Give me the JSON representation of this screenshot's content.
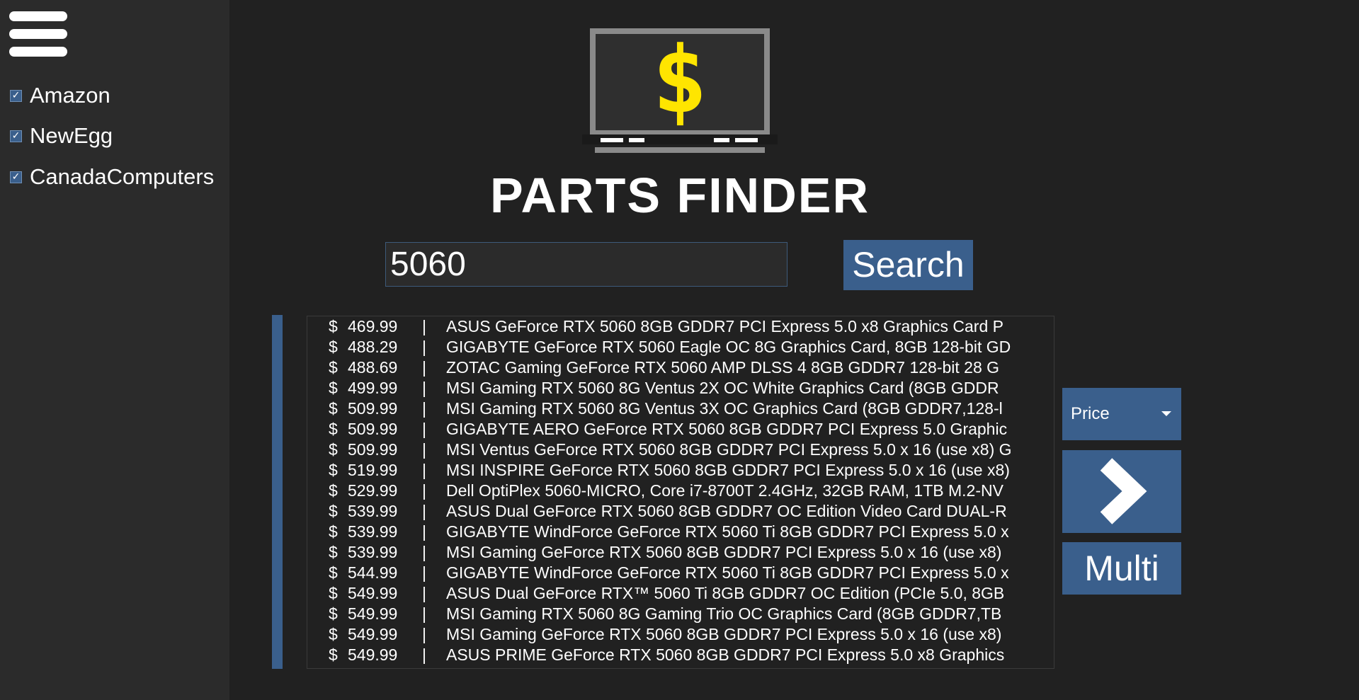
{
  "app": {
    "title": "PARTS FINDER"
  },
  "colors": {
    "background": "#212121",
    "sidebar": "#2b2b2b",
    "accent": "#3a5f8c",
    "logo_dollar": "#ffe500",
    "logo_frame": "#8a8a8a"
  },
  "sidebar": {
    "menu_icon": "hamburger-menu-icon",
    "stores": [
      {
        "label": "Amazon",
        "checked": true
      },
      {
        "label": "NewEgg",
        "checked": true
      },
      {
        "label": "CanadaComputers",
        "checked": true
      }
    ],
    "check_glyph": "✓"
  },
  "logo": {
    "icon": "monitor-dollar-icon",
    "glyph": "$"
  },
  "search": {
    "value": "5060",
    "button_label": "Search"
  },
  "results": {
    "currency": "$",
    "separator": "|",
    "rows": [
      {
        "price": "469.99",
        "name": "ASUS GeForce RTX 5060 8GB GDDR7 PCI Express 5.0 x8 Graphics Card P"
      },
      {
        "price": "488.29",
        "name": "GIGABYTE GeForce RTX 5060 Eagle OC 8G Graphics Card, 8GB 128-bit GD"
      },
      {
        "price": "488.69",
        "name": "ZOTAC Gaming GeForce RTX 5060 AMP DLSS 4 8GB GDDR7 128-bit 28 G"
      },
      {
        "price": "499.99",
        "name": "MSI Gaming RTX 5060 8G Ventus 2X OC White Graphics Card (8GB GDDR"
      },
      {
        "price": "509.99",
        "name": "MSI Gaming RTX 5060 8G Ventus 3X OC Graphics Card (8GB GDDR7,128-l"
      },
      {
        "price": "509.99",
        "name": "GIGABYTE AERO GeForce RTX 5060 8GB GDDR7 PCI Express 5.0 Graphic"
      },
      {
        "price": "509.99",
        "name": "MSI Ventus GeForce RTX 5060 8GB GDDR7 PCI Express 5.0 x 16 (use x8) G"
      },
      {
        "price": "519.99",
        "name": "MSI INSPIRE GeForce RTX 5060 8GB GDDR7 PCI Express 5.0 x 16 (use x8)"
      },
      {
        "price": "529.99",
        "name": "Dell OptiPlex 5060-MICRO, Core i7-8700T 2.4GHz, 32GB RAM, 1TB M.2-NV"
      },
      {
        "price": "539.99",
        "name": "ASUS Dual GeForce RTX 5060 8GB GDDR7 OC Edition Video Card DUAL-R"
      },
      {
        "price": "539.99",
        "name": "GIGABYTE WindForce GeForce RTX 5060 Ti 8GB GDDR7 PCI Express 5.0 x"
      },
      {
        "price": "539.99",
        "name": "MSI Gaming GeForce RTX 5060 8GB GDDR7 PCI Express 5.0 x 16 (use x8)"
      },
      {
        "price": "544.99",
        "name": "GIGABYTE WindForce GeForce RTX 5060 Ti 8GB GDDR7 PCI Express 5.0 x"
      },
      {
        "price": "549.99",
        "name": "ASUS Dual GeForce RTX™ 5060 Ti 8GB GDDR7 OC Edition (PCIe 5.0, 8GB"
      },
      {
        "price": "549.99",
        "name": "MSI Gaming RTX 5060 8G Gaming Trio OC Graphics Card (8GB GDDR7,TB"
      },
      {
        "price": "549.99",
        "name": "MSI Gaming GeForce RTX 5060 8GB GDDR7 PCI Express 5.0 x 16 (use x8)"
      },
      {
        "price": "549.99",
        "name": "ASUS PRIME GeForce RTX 5060 8GB GDDR7 PCI Express 5.0 x8 Graphics"
      }
    ]
  },
  "sort": {
    "selected": "Price",
    "caret_icon": "caret-down-icon"
  },
  "next_button": {
    "icon": "chevron-right-icon"
  },
  "multi_button": {
    "label": "Multi"
  }
}
